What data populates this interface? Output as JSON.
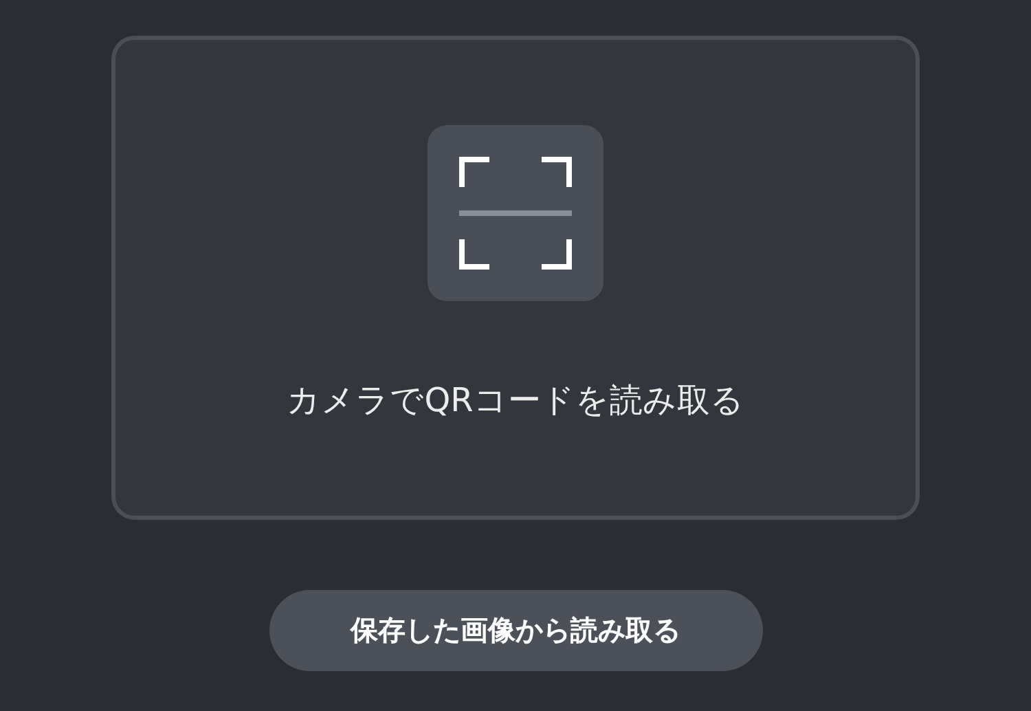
{
  "scan_card": {
    "label": "カメラでQRコードを読み取る"
  },
  "image_button": {
    "label": "保存した画像から読み取る"
  }
}
